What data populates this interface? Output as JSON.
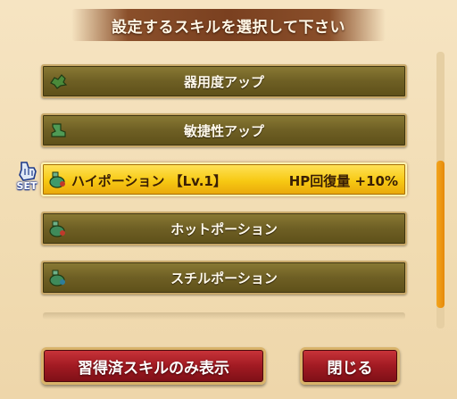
{
  "header": {
    "title": "設定するスキルを選択して下さい"
  },
  "skills": [
    {
      "label": "器用度アップ",
      "icon": "leaf-icon"
    },
    {
      "label": "敏捷性アップ",
      "icon": "boot-icon"
    },
    {
      "name": "ハイポーション 【Lv.1】",
      "effect": "HP回復量 +10%",
      "icon": "potion-icon",
      "selected": true
    },
    {
      "label": "ホットポーション",
      "icon": "potion-icon"
    },
    {
      "label": "スチルポーション",
      "icon": "potion-icon"
    }
  ],
  "set_badge": {
    "text": "SET"
  },
  "buttons": {
    "learned_only": "習得済スキルのみ表示",
    "close": "閉じる"
  },
  "colors": {
    "row_bg": "#6e5f24",
    "selected_bg": "#f7c913",
    "button_red": "#a11a22",
    "header_brown": "#7a4020",
    "scroll_thumb": "#f3a51e"
  }
}
